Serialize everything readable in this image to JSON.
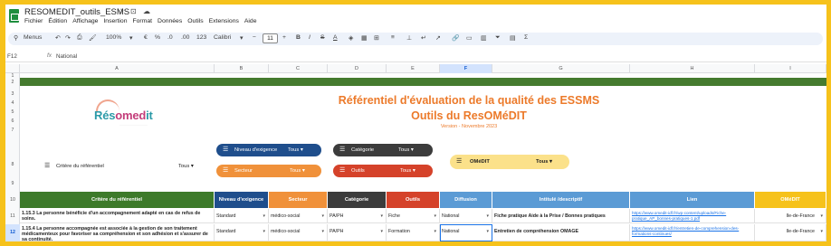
{
  "app": {
    "title": "RESOMEDIT_outils_ESMS",
    "menu": [
      "Fichier",
      "Édition",
      "Affichage",
      "Insertion",
      "Format",
      "Données",
      "Outils",
      "Extensions",
      "Aide"
    ]
  },
  "toolbar": {
    "menus_label": "Menus",
    "zoom": "100%",
    "euro": "€",
    "percent": "%",
    "dec_less": ".0",
    "dec_more": ".00",
    "num_format": "123",
    "font": "Calibri",
    "font_size": "11",
    "minus": "−",
    "plus": "+",
    "bold": "B",
    "italic": "I",
    "strike": "S",
    "text_color": "A"
  },
  "formula": {
    "cell": "F12",
    "fx": "fx",
    "value": "National"
  },
  "columns": [
    "A",
    "B",
    "C",
    "D",
    "E",
    "F",
    "G",
    "H",
    "I"
  ],
  "rows": [
    "1",
    "2",
    "3",
    "4",
    "5",
    "6",
    "7",
    "8",
    "9",
    "10",
    "11",
    "12"
  ],
  "banner": {
    "logo_text_a": "Rés",
    "logo_text_b": "omed",
    "logo_text_c": "it",
    "title": "Référentiel d'évaluation de la qualité des ESSMS",
    "subtitle": "Outils du ResOMéDIT",
    "version": "Version - Novembre 2023"
  },
  "filters": [
    {
      "label": "Critère du référentiel",
      "value": "Tous",
      "bg": "#ffffff",
      "fg": "#1f1f1f"
    },
    {
      "label": "Niveau d'exigence",
      "value": "Tous",
      "bg": "#1f4e8c",
      "fg": "#ffffff"
    },
    {
      "label": "Secteur",
      "value": "Tous",
      "bg": "#f0913a",
      "fg": "#ffffff"
    },
    {
      "label": "Catégorie",
      "value": "Tous",
      "bg": "#3c3c3c",
      "fg": "#ffffff"
    },
    {
      "label": "Outils",
      "value": "Tous",
      "bg": "#d5422a",
      "fg": "#ffffff"
    },
    {
      "label": "OMéDIT",
      "value": "Tous",
      "bg": "#fbe18a",
      "fg": "#1f1f1f"
    }
  ],
  "headers": [
    {
      "label": "Critère du référentiel",
      "bg": "#3d7a2a"
    },
    {
      "label": "Niveau d'exigence",
      "bg": "#1f4e8c"
    },
    {
      "label": "Secteur",
      "bg": "#f0913a"
    },
    {
      "label": "Catégorie",
      "bg": "#3c3c3c"
    },
    {
      "label": "Outils",
      "bg": "#d5422a"
    },
    {
      "label": "Diffusion",
      "bg": "#5b9bd5"
    },
    {
      "label": "Intitulé /descriptif",
      "bg": "#5b9bd5"
    },
    {
      "label": "Lien",
      "bg": "#5b9bd5"
    },
    {
      "label": "OMéDIT",
      "bg": "#f6c21b"
    }
  ],
  "table": [
    {
      "critere": "1.15.3 La personne bénéficie d'un accompagnement adapté en cas de refus de soins.",
      "niveau": "Standard",
      "secteur": "médico-social",
      "categorie": "PA/PH",
      "outils": "Fiche",
      "diffusion": "National",
      "intitule": "Fiche pratique  Aide à la Prise / Bonnes pratiques",
      "lien": "https://www.omedit-idf.fr/wp-content/uploads/Fiche-pratique_AP_bonnes-pratiques-1.pdf",
      "omedit": "Ile-de-France"
    },
    {
      "critere": "1.15.4 La personne accompagnée est associée à la gestion de son traitement médicamenteux pour favoriser sa compréhension et son adhésion et s'assurer de sa continuité.",
      "niveau": "Standard",
      "secteur": "médico-social",
      "categorie": "PA/PH",
      "outils": "Formation",
      "diffusion": "National",
      "intitule": "Entretien de compréhension OMAGE",
      "lien": "https://www.omedit-idf.fr/entretien-de-comprehension-des-formations-continues/",
      "omedit": "Ile-de-France"
    }
  ]
}
